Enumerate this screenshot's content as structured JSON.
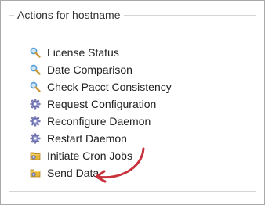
{
  "panel": {
    "title": "Actions for hostname"
  },
  "actions": [
    {
      "label": "License Status",
      "icon": "magnifier-icon"
    },
    {
      "label": "Date Comparison",
      "icon": "magnifier-icon"
    },
    {
      "label": "Check Pacct Consistency",
      "icon": "magnifier-icon"
    },
    {
      "label": "Request Configuration",
      "icon": "gear-icon"
    },
    {
      "label": "Reconfigure Daemon",
      "icon": "gear-icon"
    },
    {
      "label": "Restart Daemon",
      "icon": "gear-icon"
    },
    {
      "label": "Initiate Cron Jobs",
      "icon": "folder-gear-icon"
    },
    {
      "label": "Send Data",
      "icon": "folder-gear-icon"
    }
  ],
  "colors": {
    "arrow": "#c8323c",
    "magnifier_lens": "#5aa0d8",
    "magnifier_handle": "#c89a3a",
    "gear": "#8a8ec8",
    "folder": "#e8b83a"
  }
}
